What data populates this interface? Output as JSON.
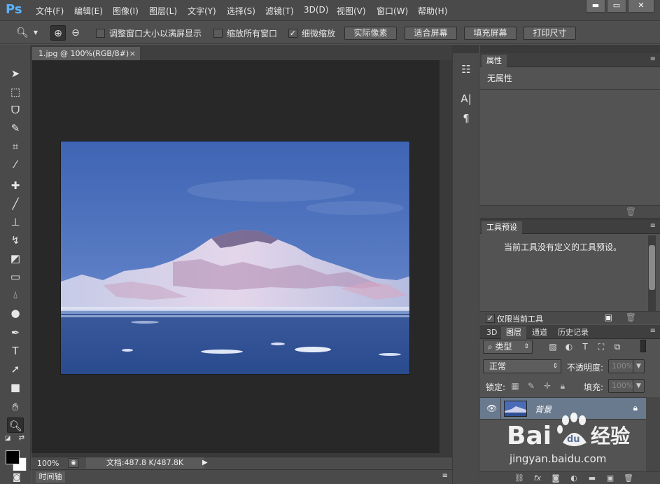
{
  "app": {
    "logo": "Ps"
  },
  "menu": [
    "文件(F)",
    "编辑(E)",
    "图像(I)",
    "图层(L)",
    "文字(Y)",
    "选择(S)",
    "滤镜(T)",
    "3D(D)",
    "视图(V)",
    "窗口(W)",
    "帮助(H)"
  ],
  "window_controls": {
    "minimize": "▬",
    "restore": "▭",
    "close": "✕"
  },
  "options": {
    "checks": [
      {
        "label": "调整窗口大小以满屏显示",
        "checked": false
      },
      {
        "label": "缩放所有窗口",
        "checked": false
      },
      {
        "label": "细微缩放",
        "checked": true
      }
    ],
    "buttons": [
      "实际像素",
      "适合屏幕",
      "填充屏幕",
      "打印尺寸"
    ]
  },
  "document": {
    "tab_title": "1.jpg @ 100%(RGB/8#)",
    "tab_close": "×",
    "zoom": "100%",
    "doc_info": "文档:487.8 K/487.8K"
  },
  "timeline": {
    "label": "时间轴"
  },
  "properties": {
    "tab": "属性",
    "body": "无属性"
  },
  "tool_presets": {
    "tab": "工具预设",
    "body": "当前工具没有定义的工具预设。",
    "current_only_label": "仅限当前工具",
    "current_only_checked": true
  },
  "layers_panel": {
    "tabs": [
      "3D",
      "图层",
      "通道",
      "历史记录"
    ],
    "active_tab": "图层",
    "filter": "类型",
    "blend_mode": "正常",
    "opacity_label": "不透明度:",
    "opacity": "100%",
    "lock_label": "锁定:",
    "fill_label": "填充:",
    "fill": "100%",
    "layers": [
      {
        "name": "背景",
        "visible": true,
        "locked": true
      }
    ]
  },
  "watermark": {
    "text": "jingyan.baidu.com"
  }
}
